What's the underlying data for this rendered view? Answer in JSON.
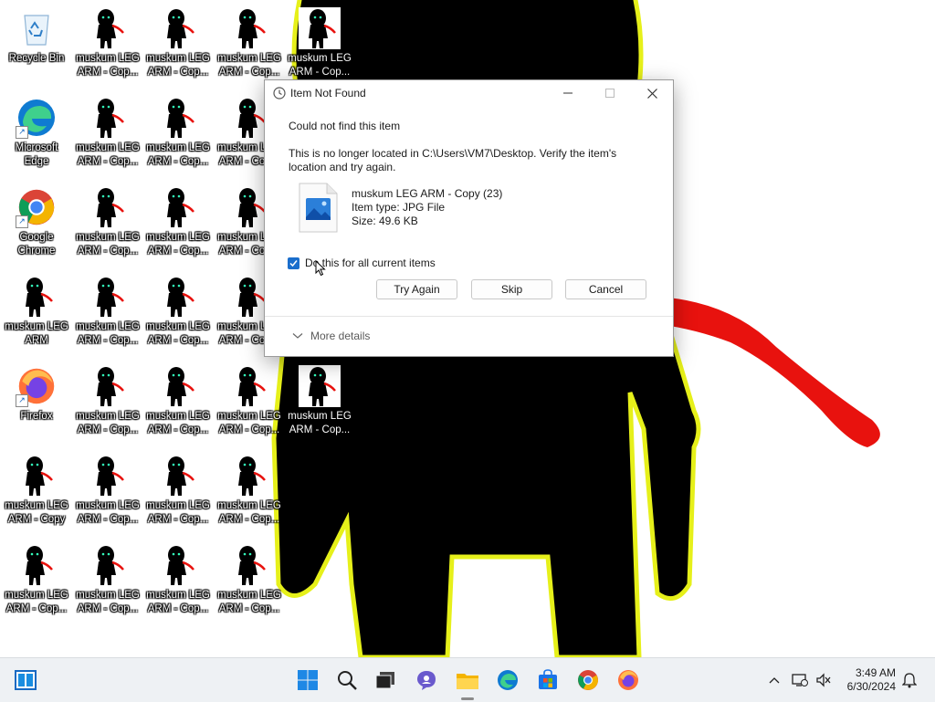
{
  "desktop": {
    "icons": [
      {
        "name": "recycle-bin",
        "label": "Recycle Bin",
        "kind": "recycle"
      },
      {
        "name": "microsoft-edge",
        "label": "Microsoft Edge",
        "kind": "edge"
      },
      {
        "name": "google-chrome",
        "label": "Google Chrome",
        "kind": "chrome"
      },
      {
        "name": "muskum-leg-arm",
        "label": "muskum LEG ARM",
        "kind": "img"
      },
      {
        "name": "firefox",
        "label": "Firefox",
        "kind": "firefox"
      },
      {
        "name": "muskum-leg-arm-copy",
        "label": "muskum LEG ARM - Copy",
        "kind": "img"
      },
      {
        "name": "muskum-leg-arm-copy-a",
        "label": "muskum LEG ARM - Cop...",
        "kind": "img"
      },
      {
        "name": "muskum-leg-arm-copy-b",
        "label": "muskum LEG ARM - Cop...",
        "kind": "img"
      },
      {
        "name": "muskum-leg-arm-copy-c",
        "label": "muskum LEG ARM - Cop...",
        "kind": "img"
      },
      {
        "name": "muskum-leg-arm-copy-d",
        "label": "muskum LEG ARM - Cop...",
        "kind": "img"
      }
    ],
    "copy_label": "muskum LEG ARM - Cop..."
  },
  "dialog": {
    "title": "Item Not Found",
    "heading": "Could not find this item",
    "message": "This is no longer located in C:\\Users\\VM7\\Desktop. Verify the item's location and try again.",
    "file": {
      "name": "muskum LEG ARM - Copy (23)",
      "type": "Item type: JPG File",
      "size": "Size: 49.6 KB"
    },
    "checkbox_label": "Do this for all current items",
    "checkbox_checked": true,
    "buttons": {
      "try_again": "Try Again",
      "skip": "Skip",
      "cancel": "Cancel"
    },
    "more_details": "More details"
  },
  "taskbar": {
    "time": "3:49 AM",
    "date": "6/30/2024",
    "icons": [
      "task-view-icon",
      "start-icon",
      "search-icon",
      "widgets-icon",
      "chat-icon",
      "file-explorer-icon",
      "edge-icon",
      "store-icon",
      "chrome-icon",
      "firefox-icon"
    ]
  },
  "colors": {
    "accent": "#1a6ecc",
    "figure": "#000000",
    "outline": "#e6f01a",
    "scarf": "#e8120e"
  }
}
